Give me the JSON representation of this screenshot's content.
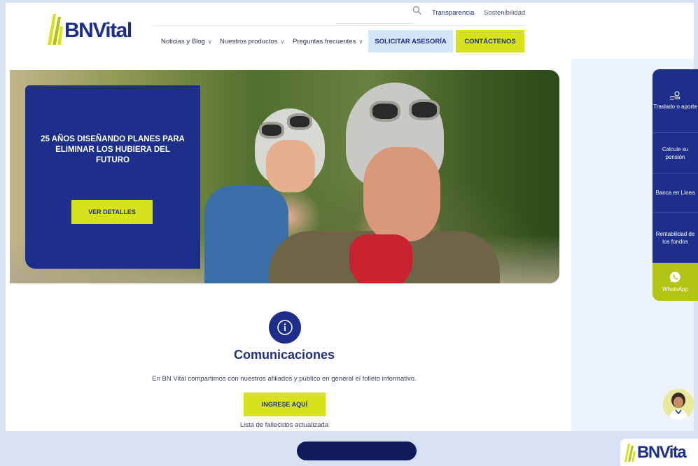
{
  "brand": {
    "logo_text_bn": "BN",
    "logo_text_vital": "Vital",
    "bottom_logo_text": "BNVita",
    "primary_color": "#1d2f8a",
    "accent_color": "#d8e21a"
  },
  "header": {
    "top_links": [
      "Transparencia",
      "Sostenibilidad"
    ],
    "nav": [
      {
        "label": "Noticias y Blog"
      },
      {
        "label": "Nuestros productos"
      },
      {
        "label": "Preguntas frecuentes"
      }
    ],
    "asesoria_label": "SOLICITAR ASESORÍA",
    "contacto_label": "CONTÁCTENOS"
  },
  "hero": {
    "title": "25 AÑOS DISEÑANDO PLANES PARA ELIMINAR LOS HUBIERA DEL FUTURO",
    "button_label": "VER DETALLES"
  },
  "communications": {
    "title": "Comunicaciones",
    "description": "En BN Vital compartimos con nuestros afiliados y público en general el folleto informativo.",
    "button_label": "INGRESE AQUÍ",
    "link_text": "Lista de fallecidos actualizada"
  },
  "side_panel": {
    "items": [
      {
        "label": "Traslado o aporte",
        "icon": "hand-coin-icon"
      },
      {
        "label": "Calcule su pensión"
      },
      {
        "label": "Banca en Línea"
      },
      {
        "label": "Rentabilidad de los fondos"
      }
    ],
    "whatsapp_label": "WhatsApp"
  }
}
